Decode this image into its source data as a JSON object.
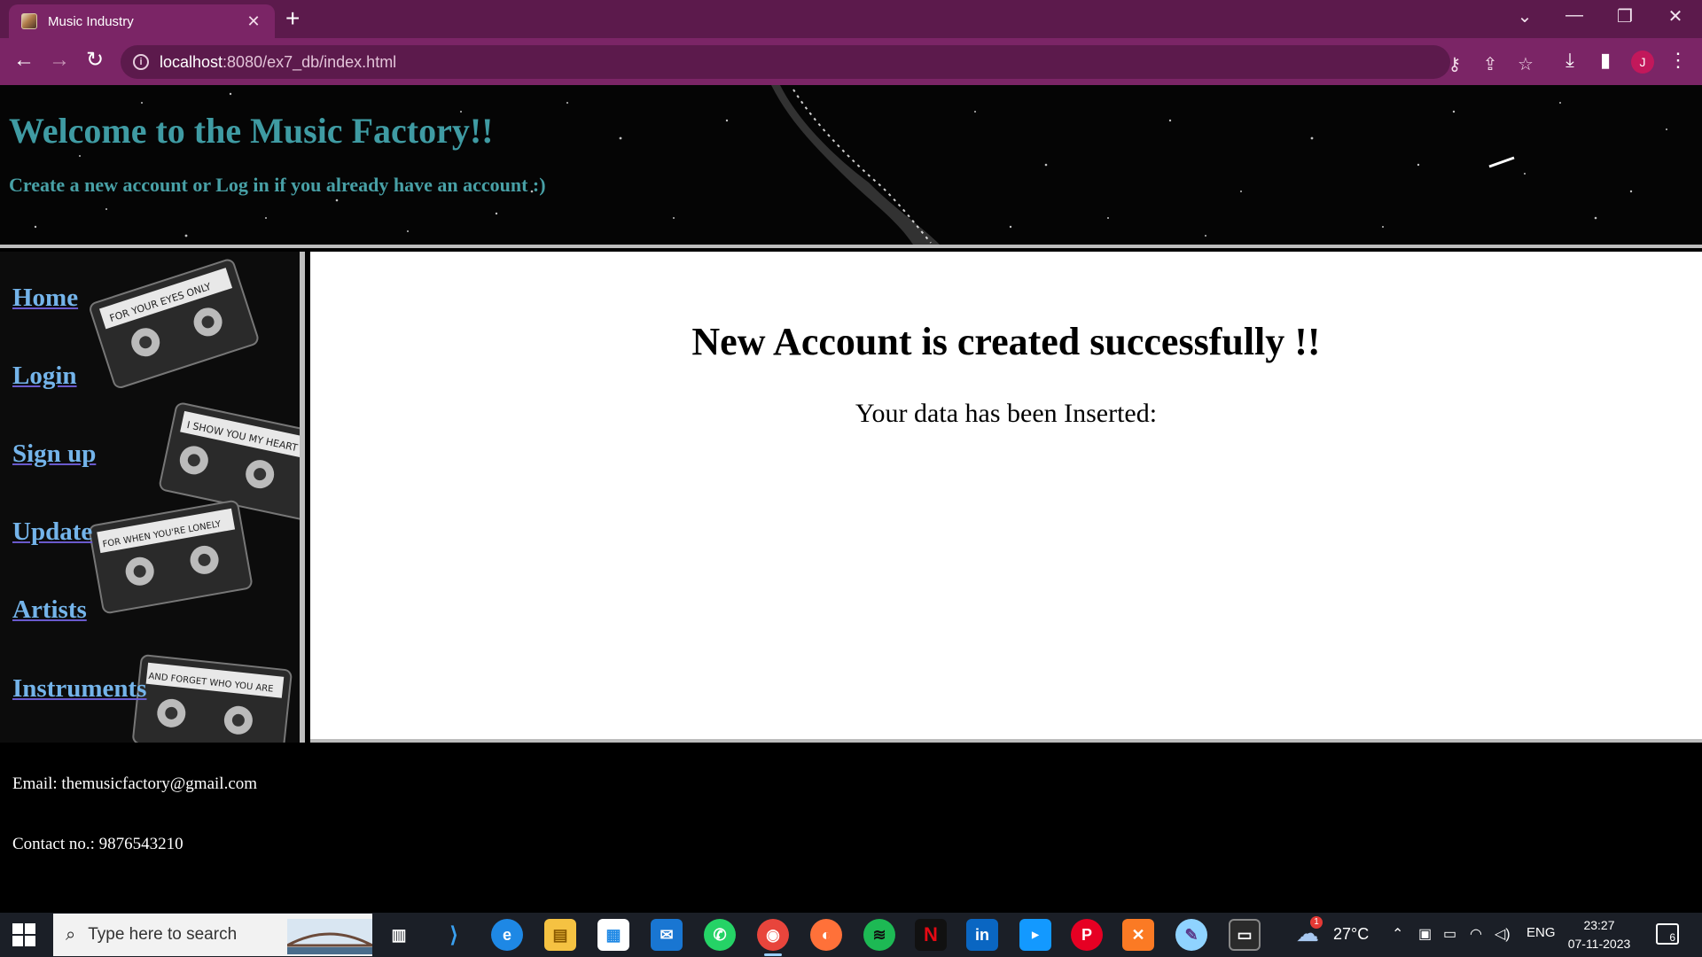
{
  "browser": {
    "tab_title": "Music Industry",
    "tab_close": "✕",
    "new_tab": "+",
    "url_host": "localhost",
    "url_path": ":8080/ex7_db/index.html",
    "profile_initial": "J",
    "window_controls": {
      "dropdown": "⌄",
      "minimize": "—",
      "restore": "❐",
      "close": "✕"
    }
  },
  "page": {
    "header": {
      "title": "Welcome to the Music Factory!!",
      "subtitle": "Create a new account or Log in if you already have an account :)"
    },
    "sidebar": {
      "items": [
        {
          "label": "Home"
        },
        {
          "label": "Login"
        },
        {
          "label": "Sign up"
        },
        {
          "label": "Update"
        },
        {
          "label": "Artists"
        },
        {
          "label": "Instruments"
        }
      ]
    },
    "cassette_labels": [
      "FOR YOUR EYES ONLY",
      "I SHOW YOU MY HEART",
      "FOR WHEN YOU'RE LONELY",
      "AND FORGET WHO YOU ARE"
    ],
    "main": {
      "heading": "New Account is created successfully !!",
      "message": "Your data has been Inserted:"
    },
    "footer": {
      "email": "Email: themusicfactory@gmail.com",
      "contact": "Contact no.: 9876543210"
    }
  },
  "taskbar": {
    "search_placeholder": "Type here to search",
    "weather": "27°C",
    "weather_badge": "1",
    "language": "ENG",
    "time": "23:27",
    "date": "07-11-2023",
    "notification_count": "6",
    "apps": [
      "task-view",
      "vscode",
      "edge",
      "file-explorer",
      "microsoft-store",
      "mail",
      "whatsapp",
      "chrome",
      "firefox",
      "spotify",
      "netflix",
      "linkedin",
      "prime-video",
      "pinterest",
      "xampp",
      "paint",
      "terminal"
    ]
  }
}
